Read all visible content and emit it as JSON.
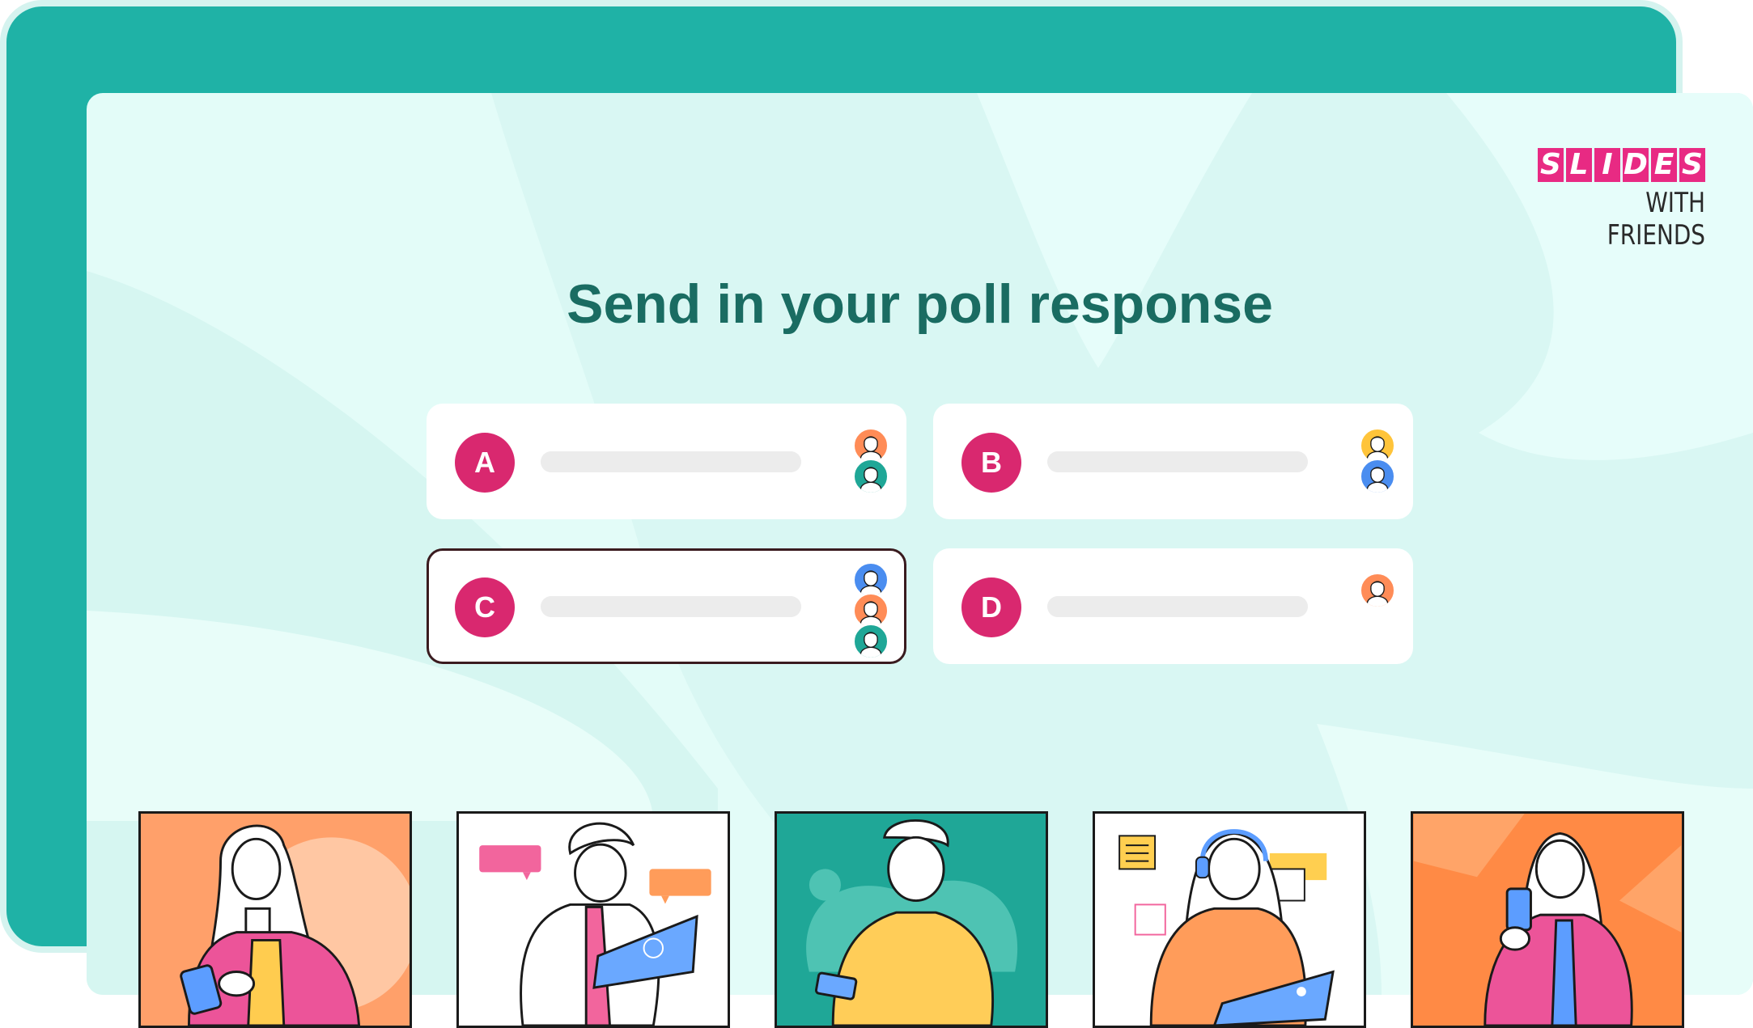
{
  "brand": {
    "logo_letters": [
      "S",
      "L",
      "I",
      "D",
      "E",
      "S"
    ],
    "logo_line2": "WITH FRIENDS",
    "colors": {
      "teal": "#1fb2a6",
      "slide_bg": "#e3fcf8",
      "accent_pink": "#d9286f",
      "title": "#1a6c62"
    }
  },
  "slide": {
    "title": "Send in your poll response"
  },
  "poll": {
    "options": [
      {
        "letter": "A",
        "selected": false,
        "voters": [
          "orange",
          "teal"
        ]
      },
      {
        "letter": "B",
        "selected": false,
        "voters": [
          "yellow",
          "blue"
        ]
      },
      {
        "letter": "C",
        "selected": true,
        "voters": [
          "blue",
          "orange",
          "teal"
        ]
      },
      {
        "letter": "D",
        "selected": false,
        "voters": [
          "orange"
        ]
      }
    ]
  },
  "participants": [
    {
      "name_icon": "woman-with-phone-illustration",
      "bg": "#ffa06a"
    },
    {
      "name_icon": "man-with-laptop-illustration",
      "bg": "#ffffff"
    },
    {
      "name_icon": "person-yellow-sweater-illustration",
      "bg": "#1fa797"
    },
    {
      "name_icon": "woman-with-headset-illustration",
      "bg": "#ffffff"
    },
    {
      "name_icon": "woman-with-phone-2-illustration",
      "bg": "#ff8a45"
    }
  ]
}
